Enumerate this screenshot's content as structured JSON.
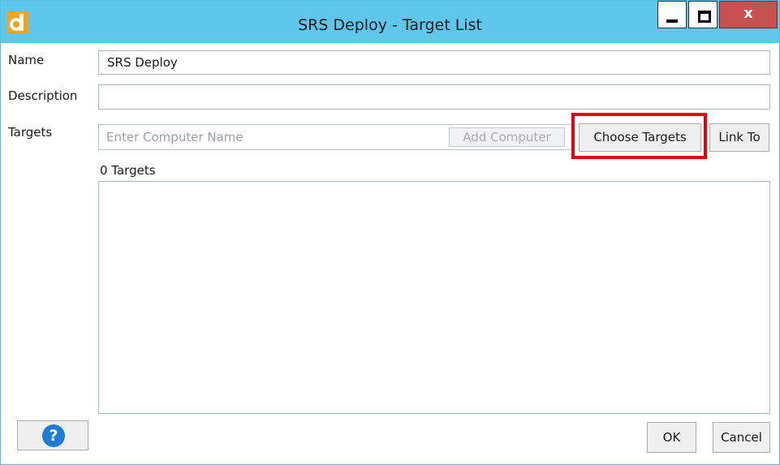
{
  "window": {
    "title": "SRS Deploy - Target List",
    "close_glyph": "x",
    "controls": {
      "minimize": "minimize-icon",
      "maximize": "maximize-icon",
      "close": "close-icon"
    },
    "titlebar_color": "#5fc6ec",
    "close_color": "#c75050"
  },
  "form": {
    "name_label": "Name",
    "name_value": "SRS Deploy",
    "description_label": "Description",
    "description_value": "",
    "targets_label": "Targets",
    "computer_placeholder": "Enter Computer Name",
    "add_computer_label": "Add Computer",
    "choose_targets_label": "Choose Targets",
    "link_to_label": "Link To",
    "targets_count": "0 Targets",
    "highlight_color": "#e8000b"
  },
  "footer": {
    "help_glyph": "?",
    "ok_label": "OK",
    "cancel_label": "Cancel"
  }
}
